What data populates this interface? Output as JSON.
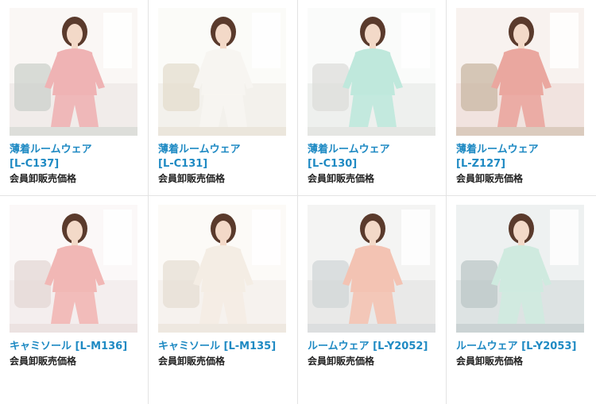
{
  "products": [
    {
      "title_line1": "薄着ルームウェア",
      "title_line2": "[L-C137]",
      "price_label": "会員卸販売価格",
      "image": "pink-pajama-set-photo",
      "colors": {
        "bg": "#f1ecea",
        "wall": "#faf7f5",
        "garment": "#efb3b4",
        "accent": "#c9cfc9"
      }
    },
    {
      "title_line1": "薄着ルームウェア",
      "title_line2": "[L-C131]",
      "price_label": "会員卸販売価格",
      "image": "white-pajama-set-photo",
      "colors": {
        "bg": "#f3f1ec",
        "wall": "#fbfbf8",
        "garment": "#f7f5f1",
        "accent": "#e3dccc"
      }
    },
    {
      "title_line1": "薄着ルームウェア",
      "title_line2": "[L-C130]",
      "price_label": "会員卸販売価格",
      "image": "mint-nightgown-photo",
      "colors": {
        "bg": "#eef0ee",
        "wall": "#fafbfa",
        "garment": "#bfe8dc",
        "accent": "#dcdcd8"
      }
    },
    {
      "title_line1": "薄着ルームウェア",
      "title_line2": "[L-Z127]",
      "price_label": "会員卸販売価格",
      "image": "coral-pajama-set-photo",
      "colors": {
        "bg": "#f1e3df",
        "wall": "#f8f2ef",
        "garment": "#eaa79f",
        "accent": "#c6b39e"
      }
    },
    {
      "title_line1": "キャミソール [L-M136]",
      "title_line2": "",
      "price_label": "会員卸販売価格",
      "image": "pink-lace-camisole-set-photo",
      "colors": {
        "bg": "#f4eeee",
        "wall": "#fbf8f8",
        "garment": "#f1b7b5",
        "accent": "#e3d5d3"
      }
    },
    {
      "title_line1": "キャミソール [L-M135]",
      "title_line2": "",
      "price_label": "会員卸販売価格",
      "image": "ivory-satin-camisole-set-photo",
      "colors": {
        "bg": "#f6f2ee",
        "wall": "#fcfaf7",
        "garment": "#f4ede4",
        "accent": "#e6ddd1"
      }
    },
    {
      "title_line1": "ルームウェア [L-Y2052]",
      "title_line2": "",
      "price_label": "会員卸販売価格",
      "image": "peach-nightgown-collage-photo",
      "colors": {
        "bg": "#e9e9e8",
        "wall": "#f4f4f3",
        "garment": "#f3c3b3",
        "accent": "#cfd4d6"
      }
    },
    {
      "title_line1": "ルームウェア [L-Y2053]",
      "title_line2": "",
      "price_label": "会員卸販売価格",
      "image": "mint-ruffle-nightgown-collage-photo",
      "colors": {
        "bg": "#dde3e3",
        "wall": "#eef1f1",
        "garment": "#cfeadf",
        "accent": "#b9c4c5"
      }
    }
  ]
}
